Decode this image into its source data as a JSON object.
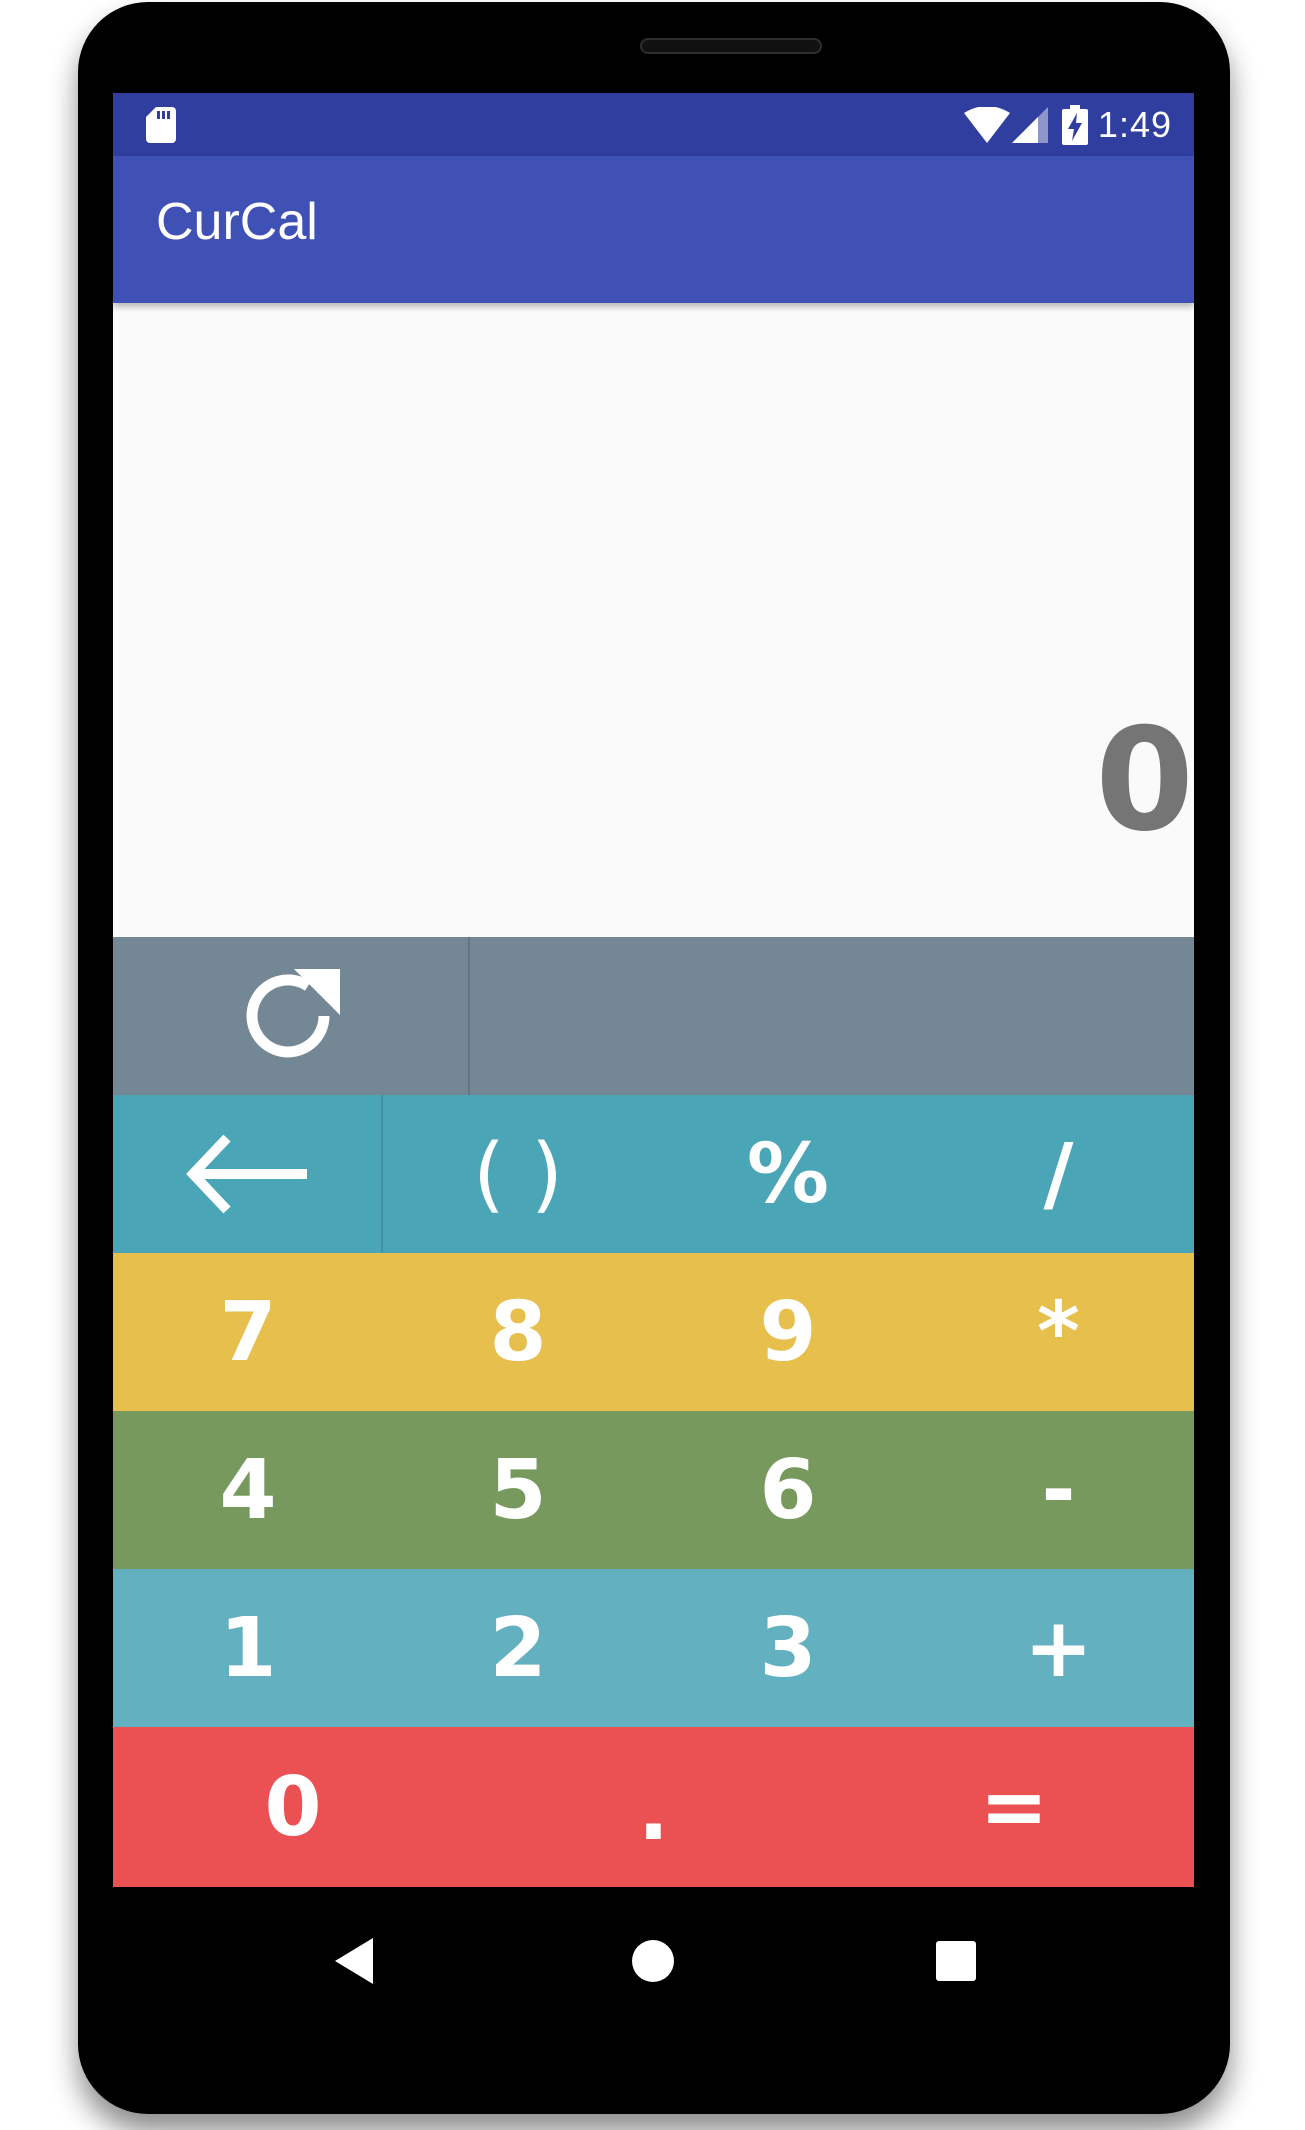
{
  "status_bar": {
    "time": "1:49",
    "icons": [
      "sd-card-icon",
      "wifi-icon",
      "signal-icon",
      "battery-charging-icon"
    ]
  },
  "app_bar": {
    "title": "CurCal"
  },
  "display": {
    "value": "0"
  },
  "keypad": {
    "utility_row": {
      "icons": [
        "refresh-icon"
      ]
    },
    "ops_row": {
      "backspace_icon": "arrow-left-icon",
      "parens": "( )",
      "percent": "%",
      "divide": "/"
    },
    "row_789": [
      "7",
      "8",
      "9",
      "*"
    ],
    "row_456": [
      "4",
      "5",
      "6",
      "-"
    ],
    "row_123": [
      "1",
      "2",
      "3",
      "+"
    ],
    "row_0": {
      "zero": "0",
      "dot": ".",
      "equals": "="
    }
  },
  "colors": {
    "status_bar": "#303f9f",
    "app_bar": "#3f51b5",
    "display_bg": "#fafafa",
    "display_text": "#757575",
    "utility_row": "#738794",
    "ops_row": "#4aa5b6",
    "row_789": "#e6bf4c",
    "row_456": "#78995e",
    "row_123": "#62b0c0",
    "row_0": "#eb5153"
  },
  "nav_bar": {
    "icons": [
      "back-icon",
      "home-icon",
      "recents-icon"
    ]
  }
}
